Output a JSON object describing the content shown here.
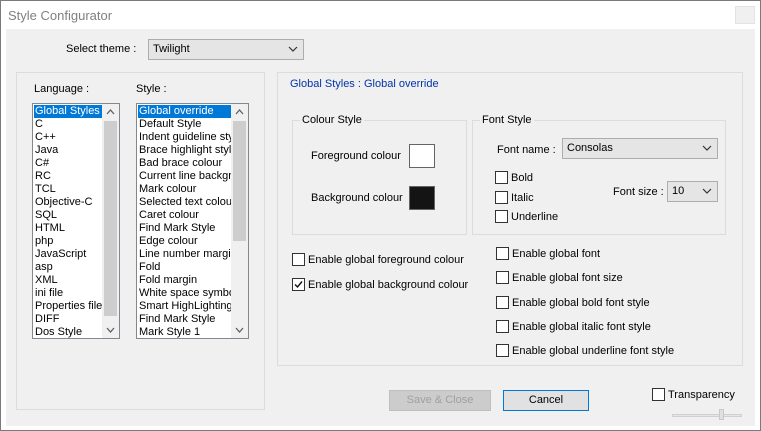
{
  "window": {
    "title": "Style Configurator"
  },
  "theme": {
    "label": "Select theme :",
    "value": "Twilight"
  },
  "language_panel": {
    "label": "Language :",
    "items": [
      "Global Styles",
      "C",
      "C++",
      "Java",
      "C#",
      "RC",
      "TCL",
      "Objective-C",
      "SQL",
      "HTML",
      "php",
      "JavaScript",
      "asp",
      "XML",
      "ini file",
      "Properties file",
      "DIFF",
      "Dos Style"
    ],
    "selected": "Global Styles"
  },
  "style_panel": {
    "label": "Style :",
    "items": [
      "Global override",
      "Default Style",
      "Indent guideline style",
      "Brace highlight style",
      "Bad brace colour",
      "Current line background colour",
      "Mark colour",
      "Selected text colour",
      "Caret colour",
      "Find Mark Style",
      "Edge colour",
      "Line number margin",
      "Fold",
      "Fold margin",
      "White space symbol",
      "Smart HighLighting",
      "Find Mark Style",
      "Mark Style 1"
    ],
    "selected": "Global override"
  },
  "heading": "Global Styles : Global override",
  "colour_style": {
    "title": "Colour Style",
    "foreground_label": "Foreground colour",
    "foreground_color": "#ffffff",
    "background_label": "Background colour",
    "background_color": "#141414"
  },
  "font_style": {
    "title": "Font Style",
    "font_name_label": "Font name :",
    "font_name_value": "Consolas",
    "bold_label": "Bold",
    "bold_checked": false,
    "italic_label": "Italic",
    "italic_checked": false,
    "underline_label": "Underline",
    "underline_checked": false,
    "font_size_label": "Font size :",
    "font_size_value": "10"
  },
  "global_options": {
    "enable_fg": {
      "label": "Enable global foreground colour",
      "checked": false
    },
    "enable_bg": {
      "label": "Enable global background colour",
      "checked": true
    },
    "enable_font": {
      "label": "Enable global font",
      "checked": false
    },
    "enable_font_size": {
      "label": "Enable global font size",
      "checked": false
    },
    "enable_bold": {
      "label": "Enable global bold font style",
      "checked": false
    },
    "enable_italic": {
      "label": "Enable global italic font style",
      "checked": false
    },
    "enable_underline": {
      "label": "Enable global underline font style",
      "checked": false
    }
  },
  "buttons": {
    "save_close": "Save & Close",
    "cancel": "Cancel"
  },
  "transparency": {
    "label": "Transparency",
    "checked": false
  },
  "colors": {
    "accent": "#0078d7",
    "heading_blue": "#0033aa"
  }
}
